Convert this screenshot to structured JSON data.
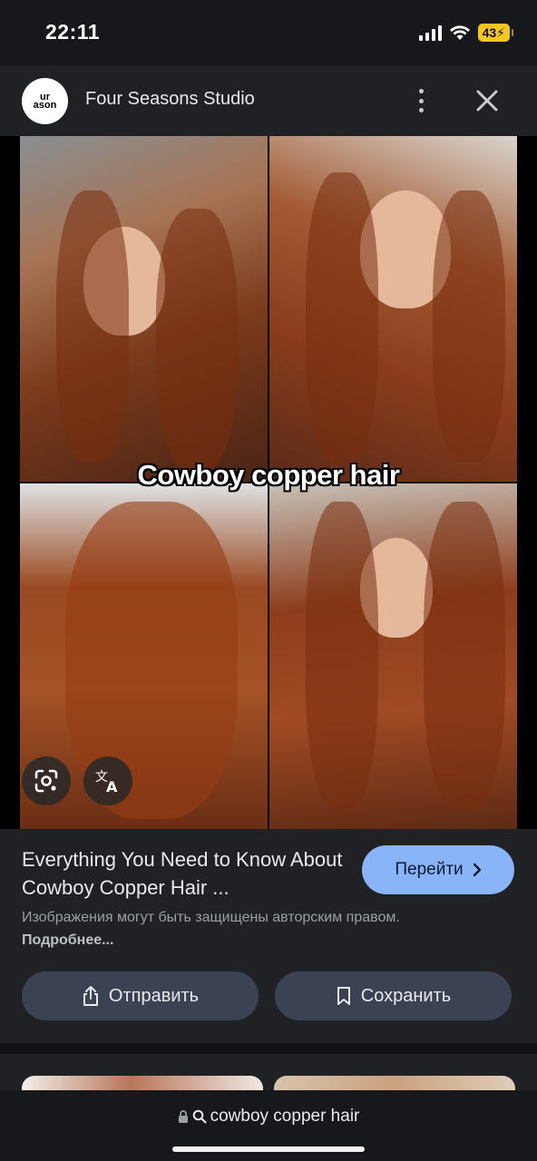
{
  "status_bar": {
    "time": "22:11",
    "battery": "43",
    "icons": [
      "cellular-signal-icon",
      "wifi-icon",
      "battery-charging-icon"
    ]
  },
  "header": {
    "logo_text": "ur\nason",
    "site_name": "Four Seasons Studio",
    "icons": [
      "more-vert-icon",
      "close-icon"
    ]
  },
  "image": {
    "caption": "Cowboy copper hair",
    "overlay_icons": [
      "google-lens-icon",
      "translate-icon"
    ]
  },
  "result": {
    "title": "Everything You Need to Know About Cowboy Copper Hair ...",
    "visit_label": "Перейти",
    "copyright_text": "Изображения могут быть защищены авторским правом.",
    "copyright_link": "Подробнее...",
    "share_label": "Отправить",
    "save_label": "Сохранить"
  },
  "address_bar": {
    "query": "cowboy copper hair"
  },
  "colors": {
    "background": "#111214",
    "panel": "#1f2124",
    "accent_button": "#8ab4f8",
    "secondary_button": "#3a4254",
    "battery": "#f3c623"
  }
}
